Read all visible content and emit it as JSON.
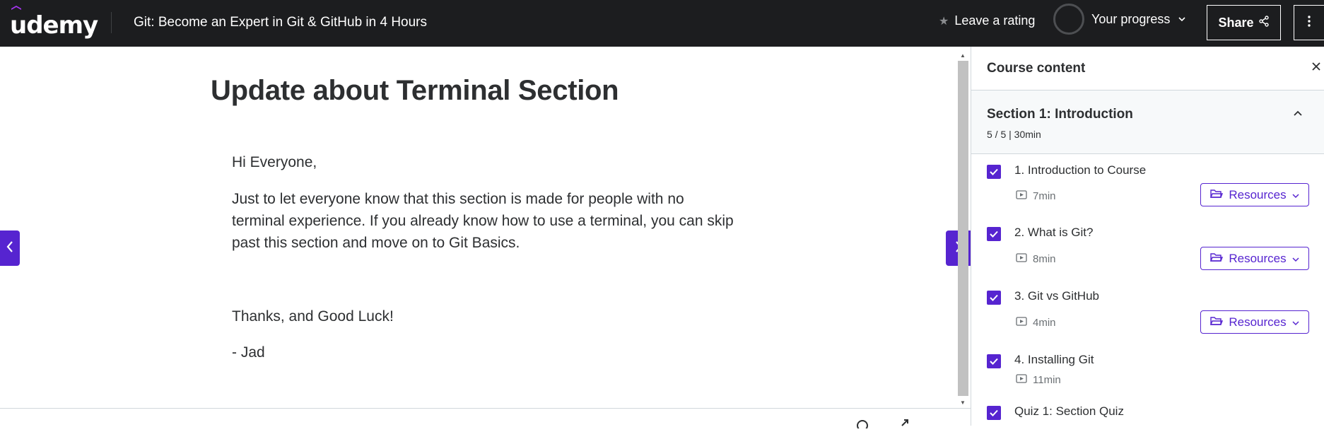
{
  "header": {
    "logo": "udemy",
    "course_title": "Git: Become an Expert in Git & GitHub in 4 Hours",
    "rating_label": "Leave a rating",
    "progress_label": "Your progress",
    "share_label": "Share",
    "colors": {
      "bar": "#1c1d1f",
      "brand": "#a435f0"
    }
  },
  "lecture": {
    "title": "Update about Terminal Section",
    "greeting": "Hi Everyone,",
    "paragraph": "Just to let everyone know that this section is made for people with no terminal experience. If you already know how to use a terminal, you can skip past this section and move on to Git Basics.",
    "thanks": "Thanks, and Good Luck!",
    "signature": "- Jad"
  },
  "navigation": {
    "prev_icon": "chevron-left-icon",
    "next_icon": "chevron-right-icon",
    "accent": "#5624d0"
  },
  "sidebar": {
    "title": "Course content",
    "section": {
      "title": "Section 1: Introduction",
      "meta": "5 / 5 | 30min"
    },
    "resources_label": "Resources",
    "items": [
      {
        "title": "1. Introduction to Course",
        "duration": "7min",
        "completed": true,
        "has_resources": true
      },
      {
        "title": "2. What is Git?",
        "duration": "8min",
        "completed": true,
        "has_resources": true
      },
      {
        "title": "3. Git vs GitHub",
        "duration": "4min",
        "completed": true,
        "has_resources": true
      },
      {
        "title": "4. Installing Git",
        "duration": "11min",
        "completed": true,
        "has_resources": false
      },
      {
        "title": "Quiz 1: Section Quiz",
        "duration": "",
        "completed": true,
        "has_resources": false
      }
    ]
  }
}
